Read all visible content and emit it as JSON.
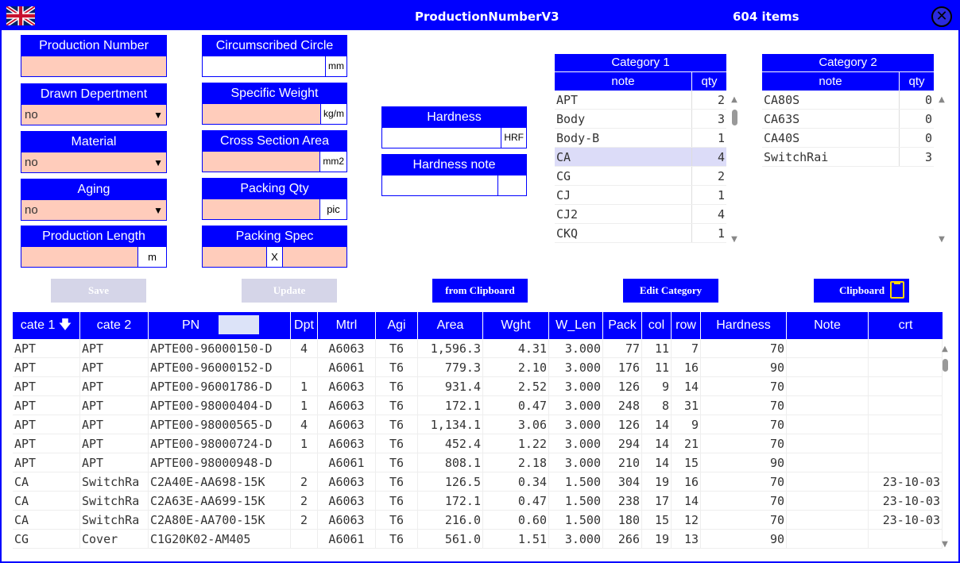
{
  "window": {
    "title": "ProductionNumberV3",
    "item_count": "604 items",
    "close_glyph": "✕"
  },
  "form": {
    "production_number": {
      "label": "Production Number",
      "value": ""
    },
    "drawn_department": {
      "label": "Drawn Depertment",
      "value": "no"
    },
    "material": {
      "label": "Material",
      "value": "no"
    },
    "aging": {
      "label": "Aging",
      "value": "no"
    },
    "production_length": {
      "label": "Production Length",
      "value": "",
      "unit": "m"
    },
    "circumscribed_circle": {
      "label": "Circumscribed Circle",
      "value": "",
      "unit": "mm"
    },
    "specific_weight": {
      "label": "Specific Weight",
      "value": "",
      "unit": "kg/m"
    },
    "cross_section_area": {
      "label": "Cross Section Area",
      "value": "",
      "unit": "mm2"
    },
    "packing_qty": {
      "label": "Packing Qty",
      "value": "",
      "unit": "pic"
    },
    "packing_spec": {
      "label": "Packing Spec",
      "sep": "X",
      "value_a": "",
      "value_b": ""
    },
    "hardness": {
      "label": "Hardness",
      "value": "",
      "unit": "HRF"
    },
    "hardness_note": {
      "label": "Hardness note",
      "value": ""
    }
  },
  "buttons": {
    "save": "Save",
    "update": "Update",
    "from_clipboard": "from Clipboard",
    "edit_category": "Edit Category",
    "clipboard": "Clipboard"
  },
  "category1": {
    "title": "Category 1",
    "col_note": "note",
    "col_qty": "qty",
    "rows": [
      {
        "note": "APT",
        "qty": "2"
      },
      {
        "note": "Body",
        "qty": "3"
      },
      {
        "note": "Body-B",
        "qty": "1"
      },
      {
        "note": "CA",
        "qty": "4"
      },
      {
        "note": "CG",
        "qty": "2"
      },
      {
        "note": "CJ",
        "qty": "1"
      },
      {
        "note": "CJ2",
        "qty": "4"
      },
      {
        "note": "CKQ",
        "qty": "1"
      }
    ],
    "selected_index": 3
  },
  "category2": {
    "title": "Category 2",
    "col_note": "note",
    "col_qty": "qty",
    "rows": [
      {
        "note": "CA80S",
        "qty": "0"
      },
      {
        "note": "CA63S",
        "qty": "0"
      },
      {
        "note": "CA40S",
        "qty": "0"
      },
      {
        "note": "SwitchRai",
        "qty": "3"
      }
    ]
  },
  "table": {
    "columns": {
      "cate1": "cate 1",
      "cate1_sort": "🡇",
      "cate2": "cate 2",
      "pn": "PN",
      "dpt": "Dpt",
      "mtrl": "Mtrl",
      "agi": "Agi",
      "area": "Area",
      "wght": "Wght",
      "wlen": "W_Len",
      "pack": "Pack",
      "col": "col",
      "row": "row",
      "hardness": "Hardness",
      "note": "Note",
      "crt": "crt"
    },
    "rows": [
      [
        "APT",
        "APT",
        "APTE00-96000150-D",
        "4",
        "A6063",
        "T6",
        "1,596.3",
        "4.31",
        "3.000",
        "77",
        "11",
        "7",
        "70",
        "",
        ""
      ],
      [
        "APT",
        "APT",
        "APTE00-96000152-D",
        "",
        "A6061",
        "T6",
        "779.3",
        "2.10",
        "3.000",
        "176",
        "11",
        "16",
        "90",
        "",
        ""
      ],
      [
        "APT",
        "APT",
        "APTE00-96001786-D",
        "1",
        "A6063",
        "T6",
        "931.4",
        "2.52",
        "3.000",
        "126",
        "9",
        "14",
        "70",
        "",
        ""
      ],
      [
        "APT",
        "APT",
        "APTE00-98000404-D",
        "1",
        "A6063",
        "T6",
        "172.1",
        "0.47",
        "3.000",
        "248",
        "8",
        "31",
        "70",
        "",
        ""
      ],
      [
        "APT",
        "APT",
        "APTE00-98000565-D",
        "4",
        "A6063",
        "T6",
        "1,134.1",
        "3.06",
        "3.000",
        "126",
        "14",
        "9",
        "70",
        "",
        ""
      ],
      [
        "APT",
        "APT",
        "APTE00-98000724-D",
        "1",
        "A6063",
        "T6",
        "452.4",
        "1.22",
        "3.000",
        "294",
        "14",
        "21",
        "70",
        "",
        ""
      ],
      [
        "APT",
        "APT",
        "APTE00-98000948-D",
        "",
        "A6061",
        "T6",
        "808.1",
        "2.18",
        "3.000",
        "210",
        "14",
        "15",
        "90",
        "",
        ""
      ],
      [
        "CA",
        "SwitchRa",
        "C2A40E-AA698-15K",
        "2",
        "A6063",
        "T6",
        "126.5",
        "0.34",
        "1.500",
        "304",
        "19",
        "16",
        "70",
        "",
        "23-10-03"
      ],
      [
        "CA",
        "SwitchRa",
        "C2A63E-AA699-15K",
        "2",
        "A6063",
        "T6",
        "172.1",
        "0.47",
        "1.500",
        "238",
        "17",
        "14",
        "70",
        "",
        "23-10-03"
      ],
      [
        "CA",
        "SwitchRa",
        "C2A80E-AA700-15K",
        "2",
        "A6063",
        "T6",
        "216.0",
        "0.60",
        "1.500",
        "180",
        "15",
        "12",
        "70",
        "",
        "23-10-03"
      ],
      [
        "CG",
        "Cover",
        "C1G20K02-AM405",
        "",
        "A6061",
        "T6",
        "561.0",
        "1.51",
        "3.000",
        "266",
        "19",
        "13",
        "90",
        "",
        ""
      ]
    ]
  },
  "colors": {
    "accent": "#0000ff",
    "input_bg": "#ffccbb",
    "selected_row": "#dcdcf8",
    "disabled_button": "#d5d5e8"
  }
}
